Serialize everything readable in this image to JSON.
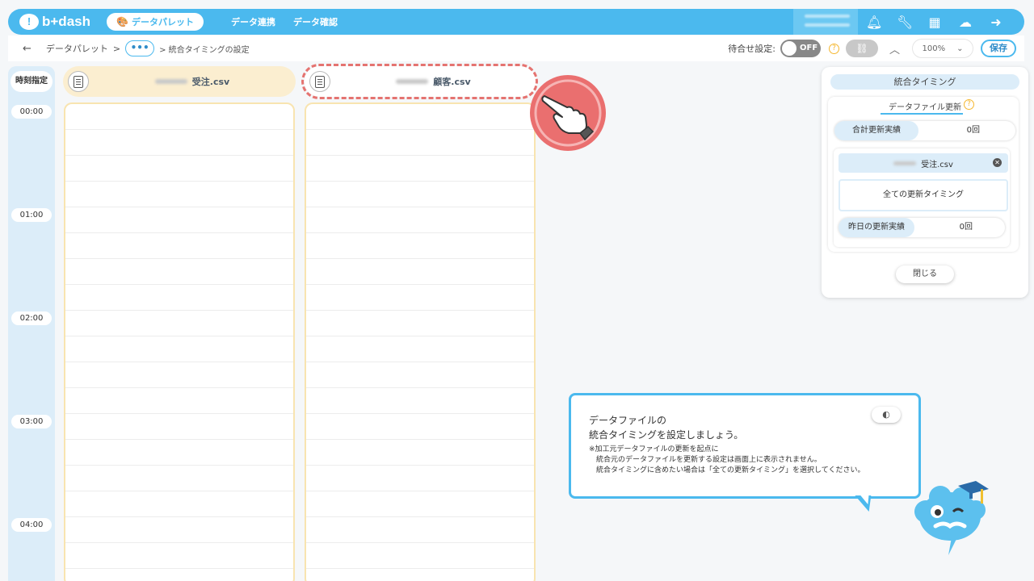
{
  "header": {
    "logo_text": "b+dash",
    "active_nav": "データパレット",
    "nav_links": [
      "データ連携",
      "データ確認"
    ]
  },
  "breadcrumb": {
    "back": "←",
    "root": "データパレット",
    "sep": ">",
    "more": "•••",
    "current": "> 統合タイミングの設定"
  },
  "toolbar": {
    "wait_label": "待合せ設定:",
    "toggle_label": "OFF",
    "help": "?",
    "zoom": "100%",
    "save": "保存"
  },
  "timeline": {
    "head": "時刻指定",
    "times": [
      "00:00",
      "01:00",
      "02:00",
      "03:00",
      "04:00"
    ]
  },
  "files": [
    {
      "name": "受注.csv"
    },
    {
      "name": "顧客.csv"
    }
  ],
  "panel": {
    "title": "統合タイミング",
    "section": "データファイル更新",
    "help": "?",
    "total_label": "合計更新実績",
    "total_value": "0回",
    "file_name": "受注.csv",
    "all_timing": "全ての更新タイミング",
    "yesterday_label": "昨日の更新実績",
    "yesterday_value": "0回",
    "close": "閉じる"
  },
  "bubble": {
    "title_line1": "データファイルの",
    "title_line2": "統合タイミングを設定しましょう。",
    "note1": "※加工元データファイルの更新を起点に",
    "note2": "統合元のデータファイルを更新する設定は画面上に表示されません。",
    "note3": "統合タイミングに含めたい場合は「全ての更新タイミング」を選択してください。"
  },
  "colors": {
    "primary": "#4bb9ee",
    "file_header": "#fbeed0",
    "highlight": "#e57370",
    "light_blue": "#dcedf9"
  }
}
